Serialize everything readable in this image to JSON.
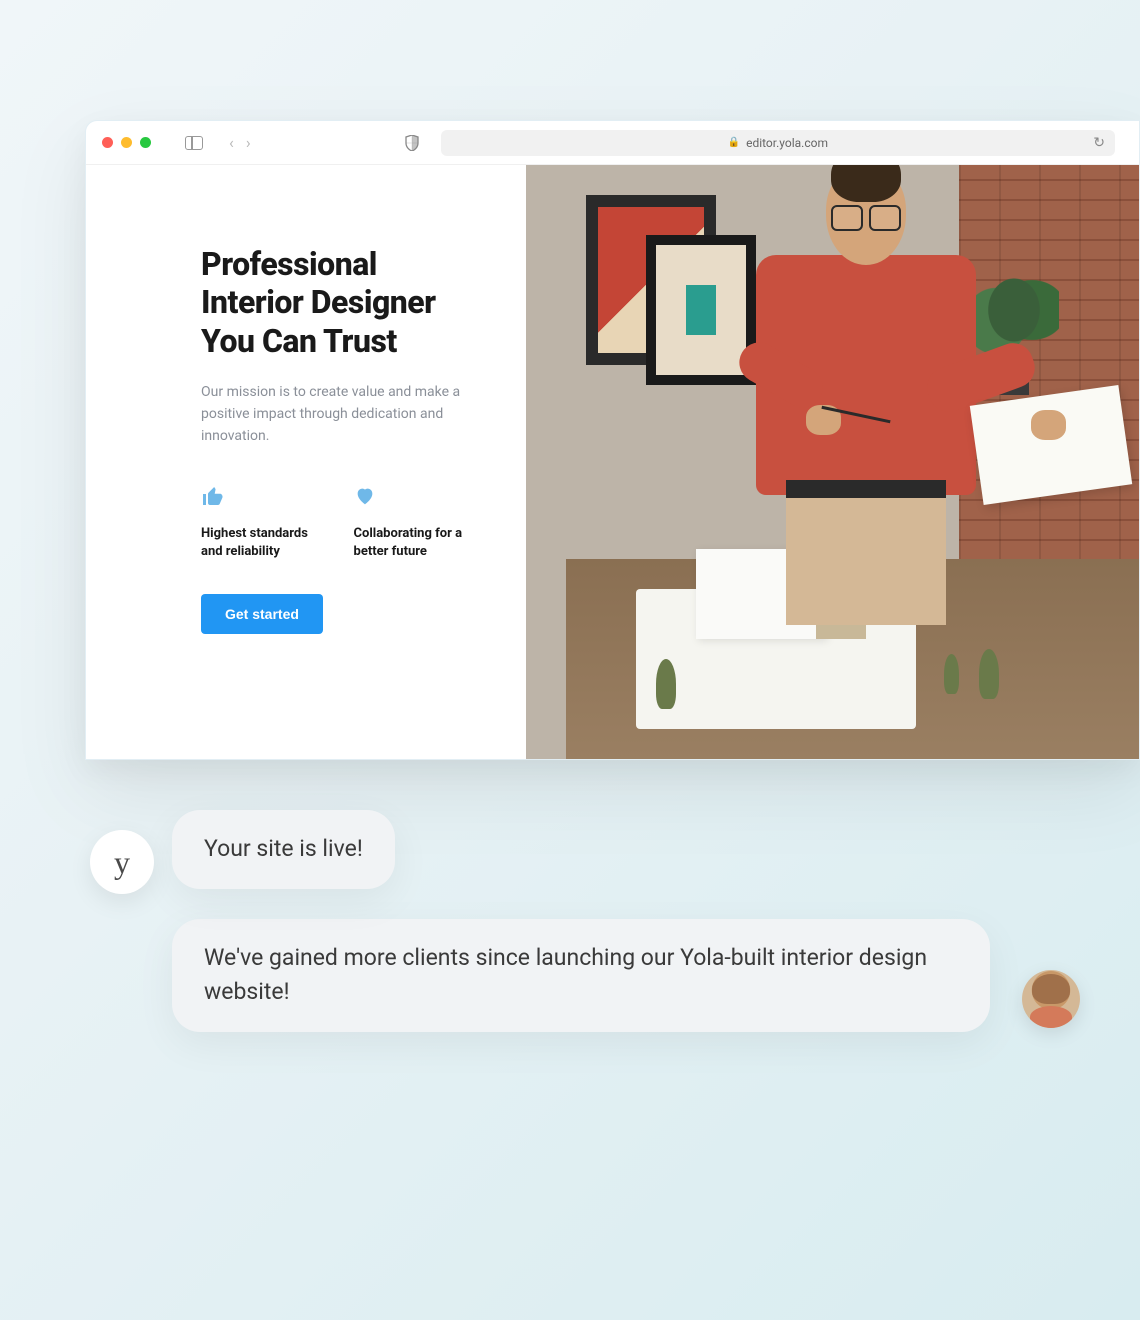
{
  "browser": {
    "url": "editor.yola.com"
  },
  "hero": {
    "title_line1": "Professional",
    "title_line2": "Interior Designer",
    "title_line3": "You Can Trust",
    "subtitle": "Our mission is to create value and make a positive impact through dedication and innovation.",
    "feature1": "Highest standards and reliability",
    "feature2": "Collaborating for a better future",
    "cta": "Get started"
  },
  "chat": {
    "yola_letter": "y",
    "bubble1": "Your site is live!",
    "bubble2": "We've gained more clients since launching our Yola-built interior design website!"
  }
}
